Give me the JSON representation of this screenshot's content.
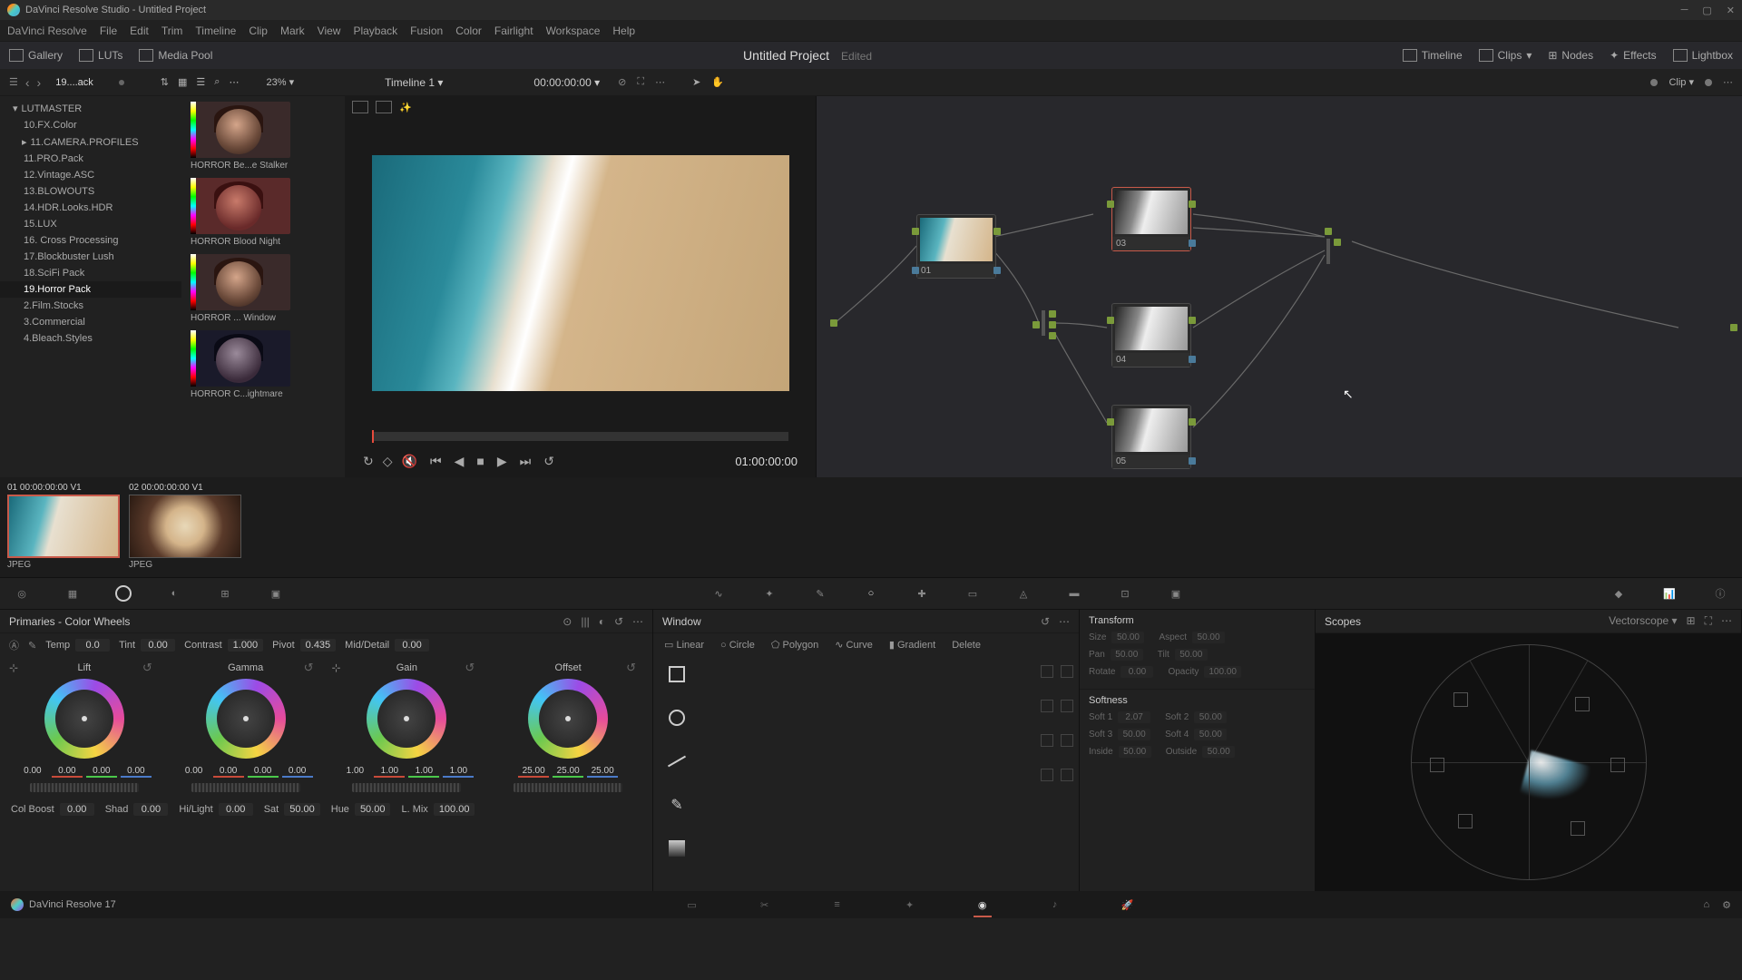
{
  "titlebar": {
    "text": "DaVinci Resolve Studio - Untitled Project"
  },
  "menu": [
    "DaVinci Resolve",
    "File",
    "Edit",
    "Trim",
    "Timeline",
    "Clip",
    "Mark",
    "View",
    "Playback",
    "Fusion",
    "Color",
    "Fairlight",
    "Workspace",
    "Help"
  ],
  "toolbar": {
    "gallery": "Gallery",
    "luts": "LUTs",
    "mediapool": "Media Pool",
    "project_title": "Untitled Project",
    "edited": "Edited",
    "timeline": "Timeline",
    "clips": "Clips",
    "nodes": "Nodes",
    "effects": "Effects",
    "lightbox": "Lightbox"
  },
  "secbar": {
    "crumb": "19....ack",
    "zoom": "23%",
    "timeline_name": "Timeline 1",
    "timecode": "00:00:00:00",
    "clip_label": "Clip"
  },
  "lut_tree": {
    "root": "LUTMASTER",
    "items": [
      "10.FX.Color",
      "11.CAMERA.PROFILES",
      "11.PRO.Pack",
      "12.Vintage.ASC",
      "13.BLOWOUTS",
      "14.HDR.Looks.HDR",
      "15.LUX",
      "16. Cross Processing",
      "17.Blockbuster Lush",
      "18.SciFi Pack",
      "19.Horror Pack",
      "2.Film.Stocks",
      "3.Commercial",
      "4.Bleach.Styles"
    ],
    "selected_index": 10
  },
  "lut_thumbs": [
    "HORROR Be...e Stalker",
    "HORROR Blood Night",
    "HORROR ... Window",
    "HORROR C...ightmare"
  ],
  "transport": {
    "timecode": "01:00:00:00"
  },
  "nodes": {
    "n1": "01",
    "n3": "03",
    "n4": "04",
    "n5": "05"
  },
  "clips": [
    {
      "meta": "01   00:00:00:00    V1",
      "type": "JPEG"
    },
    {
      "meta": "02   00:00:00:00    V1",
      "type": "JPEG"
    }
  ],
  "primaries": {
    "title": "Primaries - Color Wheels",
    "globals": {
      "temp_label": "Temp",
      "temp": "0.0",
      "tint_label": "Tint",
      "tint": "0.00",
      "contrast_label": "Contrast",
      "contrast": "1.000",
      "pivot_label": "Pivot",
      "pivot": "0.435",
      "md_label": "Mid/Detail",
      "md": "0.00"
    },
    "wheels": {
      "lift": {
        "title": "Lift",
        "v": [
          "0.00",
          "0.00",
          "0.00",
          "0.00"
        ]
      },
      "gamma": {
        "title": "Gamma",
        "v": [
          "0.00",
          "0.00",
          "0.00",
          "0.00"
        ]
      },
      "gain": {
        "title": "Gain",
        "v": [
          "1.00",
          "1.00",
          "1.00",
          "1.00"
        ]
      },
      "offset": {
        "title": "Offset",
        "v": [
          "25.00",
          "25.00",
          "25.00"
        ]
      }
    },
    "bottom": {
      "colboost_label": "Col Boost",
      "colboost": "0.00",
      "shad_label": "Shad",
      "shad": "0.00",
      "hilight_label": "Hi/Light",
      "hilight": "0.00",
      "sat_label": "Sat",
      "sat": "50.00",
      "hue_label": "Hue",
      "hue": "50.00",
      "lmix_label": "L. Mix",
      "lmix": "100.00"
    }
  },
  "window": {
    "title": "Window",
    "shapes": {
      "linear": "Linear",
      "circle": "Circle",
      "polygon": "Polygon",
      "curve": "Curve",
      "gradient": "Gradient",
      "delete": "Delete"
    }
  },
  "transform": {
    "title": "Transform",
    "size_label": "Size",
    "size": "50.00",
    "aspect_label": "Aspect",
    "aspect": "50.00",
    "pan_label": "Pan",
    "pan": "50.00",
    "tilt_label": "Tilt",
    "tilt": "50.00",
    "rotate_label": "Rotate",
    "rotate": "0.00",
    "opacity_label": "Opacity",
    "opacity": "100.00",
    "softness_title": "Softness",
    "soft1_label": "Soft 1",
    "soft1": "2.07",
    "soft2_label": "Soft 2",
    "soft2": "50.00",
    "soft3_label": "Soft 3",
    "soft3": "50.00",
    "soft4_label": "Soft 4",
    "soft4": "50.00",
    "inside_label": "Inside",
    "inside": "50.00",
    "outside_label": "Outside",
    "outside": "50.00"
  },
  "scopes": {
    "title": "Scopes",
    "type": "Vectorscope"
  },
  "footer": {
    "brand": "DaVinci Resolve 17"
  }
}
